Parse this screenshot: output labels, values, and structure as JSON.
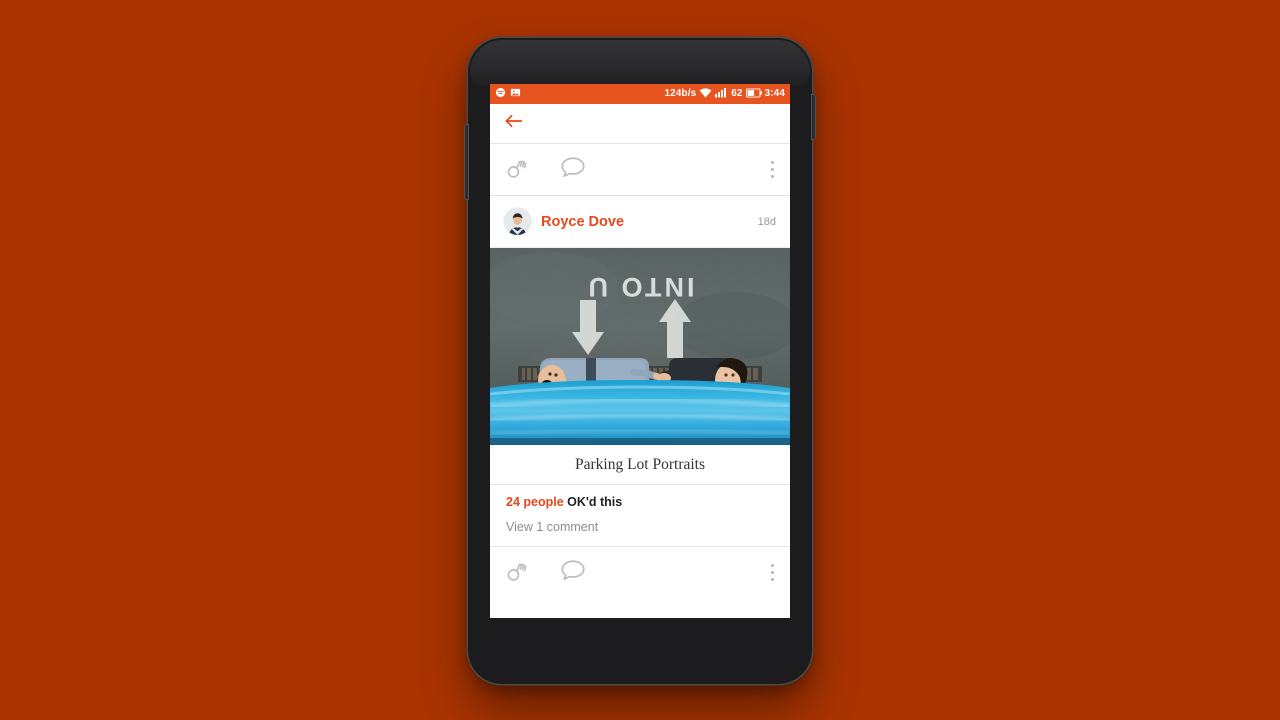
{
  "background_color": "#a93400",
  "accent_color": "#e8481c",
  "status_bar": {
    "network_speed": "124b/s",
    "battery_percent": "62",
    "clock": "3:44",
    "left_icons": [
      "chat-notification-icon",
      "screenshot-icon"
    ],
    "right_icons": [
      "wifi-icon",
      "signal-bars-icon",
      "battery-icon"
    ]
  },
  "toolbar": {
    "back_icon": "back-arrow-icon"
  },
  "top_actions": {
    "ok_label": "OK",
    "comment_label": "Comment",
    "overflow_label": "More options"
  },
  "post": {
    "author": "Royce Dove",
    "time": "18d",
    "avatar_alt": "Royce Dove avatar",
    "photo_alt": "Couple lying on pavement, upside-down, with INTO U painted on asphalt",
    "photo_text": "INTO U",
    "caption": "Parking Lot Portraits",
    "likes_count": "24 people",
    "likes_suffix": "OK'd this",
    "view_comments": "View 1 comment"
  },
  "bottom_actions": {
    "ok_label": "OK",
    "comment_label": "Comment",
    "overflow_label": "More options"
  },
  "device": {
    "front_camera": "front-camera",
    "earpiece": "earpiece-speaker",
    "volume_button": "volume-rocker",
    "power_button": "power-button"
  }
}
